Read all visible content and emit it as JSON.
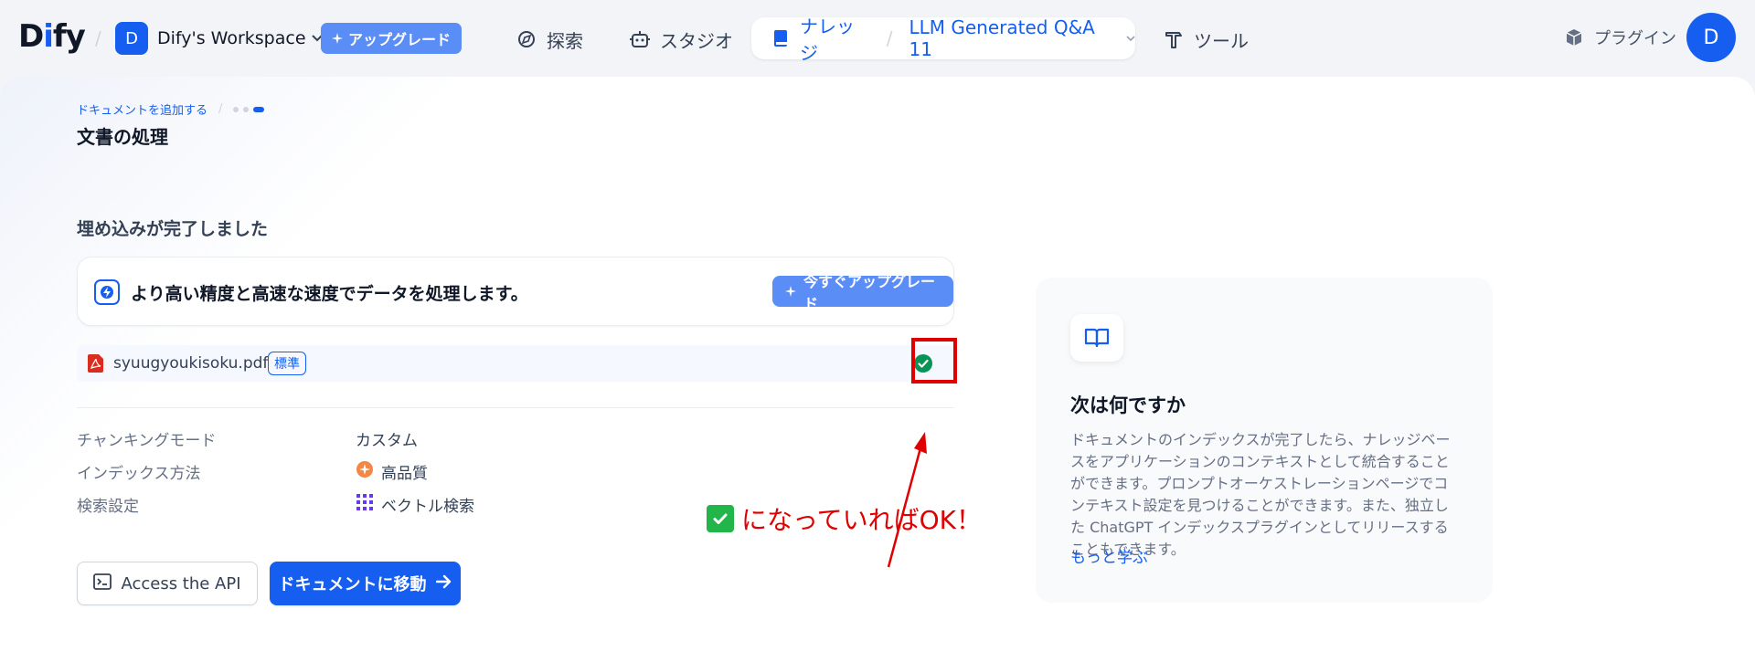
{
  "header": {
    "logo": {
      "pre": "D",
      "accent": "i",
      "post": "fy"
    },
    "workspace": {
      "initial": "D",
      "name": "Dify's Workspace"
    },
    "upgrade_label": "アップグレード",
    "nav": {
      "explore": "探索",
      "studio": "スタジオ",
      "knowledge": "ナレッジ",
      "dataset_name": "LLM Generated Q&A 11",
      "tools": "ツール"
    },
    "plugin_label": "プラグイン",
    "user_initial": "D"
  },
  "breadcrumb": {
    "step_label": "ドキュメントを追加する"
  },
  "page_title": "文書の処理",
  "embedding": {
    "done_title": "埋め込みが完了しました",
    "upgrade_text": "より高い精度と高速な速度でデータを処理します。",
    "upgrade_button": "今すぐアップグレード"
  },
  "file": {
    "name": "syuugyoukisoku.pdf",
    "badge": "標準"
  },
  "settings": [
    {
      "label": "チャンキングモード",
      "value": "カスタム"
    },
    {
      "label": "インデックス方法",
      "value": "高品質"
    },
    {
      "label": "検索設定",
      "value": "ベクトル検索"
    }
  ],
  "buttons": {
    "api": "Access the API",
    "go_docs": "ドキュメントに移動"
  },
  "annotation": {
    "text": "になっていればOK！",
    "color": "#e00000"
  },
  "next": {
    "title": "次は何ですか",
    "description": "ドキュメントのインデックスが完了したら、ナレッジベースをアプリケーションのコンテキストとして統合することができます。プロンプトオーケストレーションページでコンテキスト設定を見つけることができます。また、独立した ChatGPT インデックスプラグインとしてリリースすることもできます。",
    "learn_more": "もっと学ぶ"
  },
  "colors": {
    "accent": "#155eef",
    "success": "#079455"
  }
}
